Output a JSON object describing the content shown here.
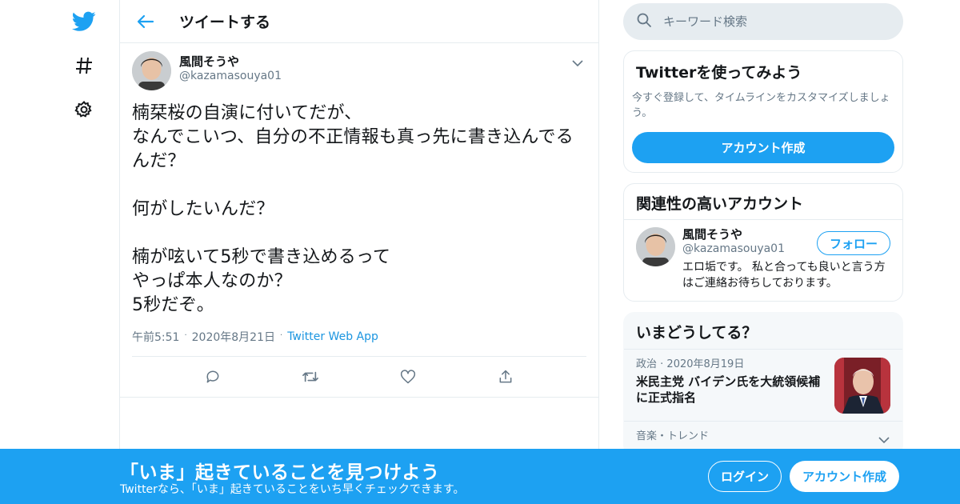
{
  "colors": {
    "accent": "#1da1f2",
    "text": "#14171a",
    "muted": "#657786",
    "border": "#e6ecf0"
  },
  "rail": {
    "icons": [
      "twitter-logo-icon",
      "hashtag-icon",
      "gear-icon"
    ]
  },
  "header": {
    "back_icon": "arrow-left-icon",
    "title": "ツイートする"
  },
  "tweet": {
    "author_name": "風間そうや",
    "author_handle": "@kazamasouya01",
    "text": "楠栞桜の自演に付いてだが、\nなんでこいつ、自分の不正情報も真っ先に書き込んでるんだ？\n\n何がしたいんだ？\n\n楠が呟いて5秒で書き込めるって\nやっぱ本人なのか？\n5秒だぞ。",
    "time": "午前5:51",
    "date": "2020年8月21日",
    "source": "Twitter Web App",
    "actions": [
      "reply-icon",
      "retweet-icon",
      "like-icon",
      "share-icon"
    ]
  },
  "search": {
    "placeholder": "キーワード検索"
  },
  "signup_card": {
    "title": "Twitterを使ってみよう",
    "description": "今すぐ登録して、タイムラインをカスタマイズしましょう。",
    "button": "アカウント作成"
  },
  "related": {
    "title": "関連性の高いアカウント",
    "name": "風間そうや",
    "handle": "@kazamasouya01",
    "bio": "エロ垢です。 私と合っても良いと言う方はご連絡お待ちしております。",
    "follow_button": "フォロー"
  },
  "trends": {
    "title": "いまどうしてる？",
    "items": [
      {
        "category": "政治",
        "date": "2020年8月19日",
        "headline": "米民主党 バイデン氏を大統領候補に正式指名"
      },
      {
        "category": "音楽・トレンド"
      }
    ]
  },
  "banner": {
    "title": "「いま」起きていることを見つけよう",
    "subtitle": "Twitterなら、「いま」起きていることをいち早くチェックできます。",
    "login": "ログイン",
    "signup": "アカウント作成"
  }
}
